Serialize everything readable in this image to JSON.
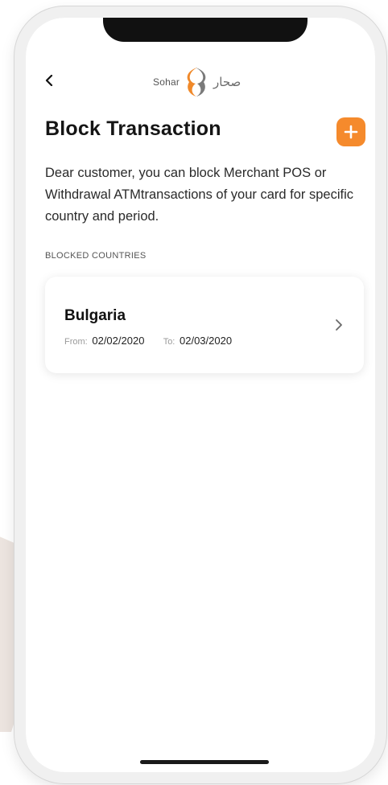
{
  "header": {
    "brand_en": "Sohar",
    "brand_ar": "صحار"
  },
  "page": {
    "title": "Block Transaction",
    "description": "Dear customer, you can block Merchant POS or Withdrawal ATMtransactions of your card for specific country and period.",
    "section_label": "BLOCKED COUNTRIES"
  },
  "blocked_countries": [
    {
      "country": "Bulgaria",
      "from_label": "From:",
      "from_date": "02/02/2020",
      "to_label": "To:",
      "to_date": "02/03/2020"
    }
  ],
  "colors": {
    "accent": "#f58a2c",
    "logo_orange": "#f0892a",
    "logo_gray": "#7a7a7a"
  },
  "icons": {
    "back": "chevron-left-icon",
    "add": "plus-icon",
    "open_item": "chevron-right-icon"
  }
}
